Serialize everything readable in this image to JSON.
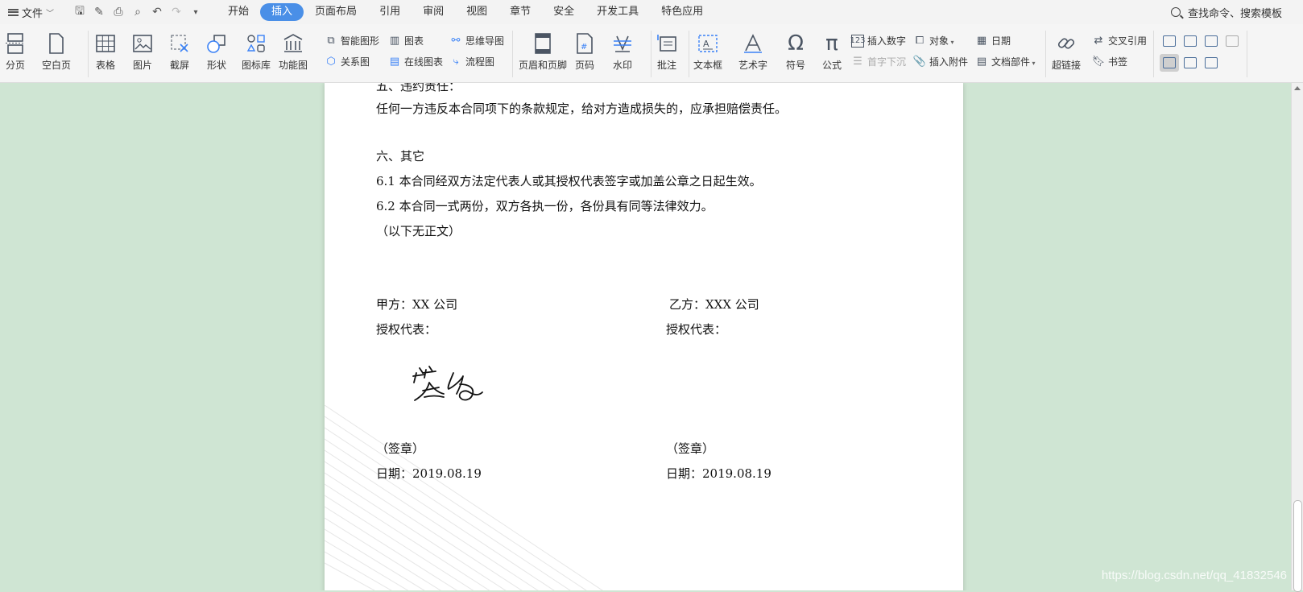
{
  "menubar": {
    "file": "文件",
    "tabs": [
      "开始",
      "插入",
      "页面布局",
      "引用",
      "审阅",
      "视图",
      "章节",
      "安全",
      "开发工具",
      "特色应用"
    ],
    "active_tab": 1,
    "search": "查找命令、搜索模板"
  },
  "ribbon": {
    "page_break": "分页",
    "blank_page": "空白页",
    "table": "表格",
    "picture": "图片",
    "screenshot": "截屏",
    "shapes": "形状",
    "icon_library": "图标库",
    "function_chart": "功能图",
    "smart_art": "智能图形",
    "chart": "图表",
    "mind_map": "思维导图",
    "relation_chart": "关系图",
    "online_chart": "在线图表",
    "flowchart": "流程图",
    "header_footer": "页眉和页脚",
    "page_number": "页码",
    "watermark": "水印",
    "comment": "批注",
    "text_box": "文本框",
    "word_art": "艺术字",
    "symbol": "符号",
    "formula": "公式",
    "insert_number": "插入数字",
    "drop_cap": "首字下沉",
    "object": "对象",
    "attachment": "插入附件",
    "date": "日期",
    "doc_parts": "文档部件",
    "hyperlink": "超链接",
    "cross_ref": "交叉引用",
    "bookmark": "书签"
  },
  "document": {
    "section5_title": "五、违约责任：",
    "section5_text": "任何一方违反本合同项下的条款规定，给对方造成损失的，应承担赔偿责任。",
    "section6_title": "六、其它",
    "clause_6_1": "6.1 本合同经双方法定代表人或其授权代表签字或加盖公章之日起生效。",
    "clause_6_2": "6.2 本合同一式两份，双方各执一份，各份具有同等法律效力。",
    "no_more_text": "（以下无正文）",
    "party_a": "甲方：XX 公司",
    "party_b": "乙方：XXX 公司",
    "rep_a": "授权代表：",
    "rep_b": "授权代表：",
    "seal_a": "（签章）",
    "seal_b": "（签章）",
    "date_a": "日期：2019.08.19",
    "date_b": "日期：2019.08.19",
    "signature": "签名"
  },
  "watermark_text": "https://blog.csdn.net/qq_41832546",
  "colors": {
    "accent": "#4a8fe7",
    "background": "#cfe5d3"
  }
}
